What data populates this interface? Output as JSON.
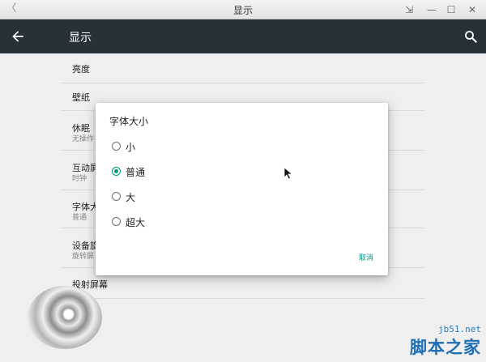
{
  "window": {
    "title": "显示",
    "back_glyph": "〈",
    "controls": {
      "resize_glyph": "⇲",
      "minimize_glyph": "—",
      "maximize_glyph": "☐",
      "close_glyph": "✕"
    }
  },
  "appbar": {
    "title": "显示",
    "back_icon": "arrow-back-icon",
    "search_icon": "search-icon",
    "background": "#263238"
  },
  "settings": {
    "items": [
      {
        "label": "亮度",
        "subtitle": ""
      },
      {
        "label": "壁纸",
        "subtitle": ""
      },
      {
        "label": "休眠",
        "subtitle": "无操作"
      },
      {
        "label": "互动屏",
        "subtitle": "时钟"
      },
      {
        "label": "字体大",
        "subtitle": "普通"
      },
      {
        "label": "设备旋",
        "subtitle": "旋转屏"
      },
      {
        "label": "投射屏幕",
        "subtitle": ""
      }
    ]
  },
  "dialog": {
    "title": "字体大小",
    "options": [
      {
        "label": "小",
        "selected": false
      },
      {
        "label": "普通",
        "selected": true
      },
      {
        "label": "大",
        "selected": false
      },
      {
        "label": "超大",
        "selected": false
      }
    ],
    "cancel_label": "取消",
    "accent": "#009688"
  },
  "watermark": {
    "url": "jb51.net",
    "name": "脚本之家"
  }
}
